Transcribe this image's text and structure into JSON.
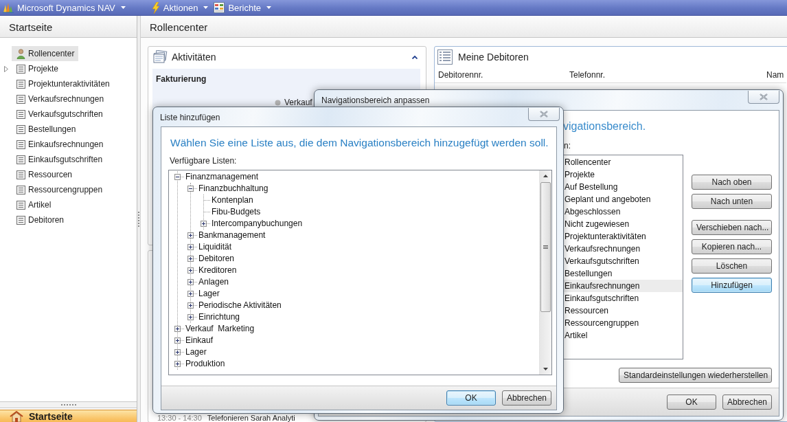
{
  "app_bar": {
    "product": "Microsoft Dynamics NAV",
    "menus": [
      {
        "kind": "actions",
        "label": "Aktionen"
      },
      {
        "kind": "reports",
        "label": "Berichte"
      }
    ]
  },
  "sidebar": {
    "title": "Startseite",
    "items": [
      {
        "kind": "role",
        "label": "Rollencenter",
        "selected": true
      },
      {
        "kind": "group",
        "label": "Projekte",
        "selected": false
      },
      {
        "kind": "list",
        "label": "Projektunteraktivitäten",
        "selected": false
      },
      {
        "kind": "list",
        "label": "Verkaufsrechnungen",
        "selected": false
      },
      {
        "kind": "list",
        "label": "Verkaufsgutschriften",
        "selected": false
      },
      {
        "kind": "list",
        "label": "Bestellungen",
        "selected": false
      },
      {
        "kind": "list",
        "label": "Einkaufsrechnungen",
        "selected": false
      },
      {
        "kind": "list",
        "label": "Einkaufsgutschriften",
        "selected": false
      },
      {
        "kind": "list",
        "label": "Ressourcen",
        "selected": false
      },
      {
        "kind": "list",
        "label": "Ressourcengruppen",
        "selected": false
      },
      {
        "kind": "list",
        "label": "Artikel",
        "selected": false
      },
      {
        "kind": "list",
        "label": "Debitoren",
        "selected": false
      }
    ],
    "footer": "Startseite"
  },
  "main": {
    "title": "Rollencenter",
    "activities": {
      "title": "Aktivitäten",
      "section": "Fakturierung",
      "cue": "Verkauf"
    },
    "agenda": {
      "time": "13:30 - 14:30",
      "subject": "Telefonieren Sarah Analyti"
    },
    "customers": {
      "title": "Meine Debitoren",
      "columns": [
        "Debitorennr.",
        "Telefonnr.",
        "Nam"
      ]
    }
  },
  "customize_dialog": {
    "title": "Navigationsbereich anpassen",
    "heading": "vigationsbereich.",
    "list_label": "n:",
    "items": [
      {
        "label": "Rollencenter",
        "selected": false
      },
      {
        "label": "Projekte",
        "selected": false
      },
      {
        "label": "Auf Bestellung",
        "selected": false
      },
      {
        "label": "Geplant und angeboten",
        "selected": false
      },
      {
        "label": "Abgeschlossen",
        "selected": false
      },
      {
        "label": "Nicht zugewiesen",
        "selected": false
      },
      {
        "label": "Projektunteraktivitäten",
        "selected": false
      },
      {
        "label": "Verkaufsrechnungen",
        "selected": false
      },
      {
        "label": "Verkaufsgutschriften",
        "selected": false
      },
      {
        "label": "Bestellungen",
        "selected": false
      },
      {
        "label": "Einkaufsrechnungen",
        "selected": true
      },
      {
        "label": "Einkaufsgutschriften",
        "selected": false
      },
      {
        "label": "Ressourcen",
        "selected": false
      },
      {
        "label": "Ressourcengruppen",
        "selected": false
      },
      {
        "label": "Artikel",
        "selected": false
      }
    ],
    "button_groups": [
      [
        {
          "label": "Nach oben",
          "default": false
        },
        {
          "label": "Nach unten",
          "default": false
        }
      ],
      [
        {
          "label": "Verschieben nach...",
          "default": false
        },
        {
          "label": "Kopieren nach...",
          "default": false
        },
        {
          "label": "Löschen",
          "default": false
        },
        {
          "label": "Hinzufügen",
          "default": true
        }
      ]
    ],
    "reset_button": "Standardeinstellungen wiederherstellen",
    "footer_buttons": [
      {
        "label": "OK",
        "default": false
      },
      {
        "label": "Abbrechen",
        "default": false
      }
    ]
  },
  "add_dialog": {
    "title": "Liste hinzufügen",
    "heading": "Wählen Sie eine Liste aus, die dem Navigationsbereich hinzugefügt werden soll.",
    "tree_label": "Verfügbare Listen:",
    "tree": [
      {
        "label": "Finanzmanagement",
        "expanded": true,
        "children": [
          {
            "label": "Finanzbuchhaltung",
            "expanded": true,
            "children": [
              {
                "label": "Kontenplan"
              },
              {
                "label": "Fibu-Budgets"
              },
              {
                "label": "Intercompanybuchungen",
                "expanded": false
              }
            ]
          },
          {
            "label": "Bankmanagement",
            "expanded": false
          },
          {
            "label": "Liquidität",
            "expanded": false
          },
          {
            "label": "Debitoren",
            "expanded": false
          },
          {
            "label": "Kreditoren",
            "expanded": false
          },
          {
            "label": "Anlagen",
            "expanded": false
          },
          {
            "label": "Lager",
            "expanded": false
          },
          {
            "label": "Periodische Aktivitäten",
            "expanded": false
          },
          {
            "label": "Einrichtung",
            "expanded": false
          }
        ]
      },
      {
        "label": "Verkauf  Marketing",
        "expanded": false
      },
      {
        "label": "Einkauf",
        "expanded": false
      },
      {
        "label": "Lager",
        "expanded": false
      },
      {
        "label": "Produktion",
        "expanded": false
      }
    ],
    "footer_buttons": [
      {
        "label": "OK",
        "default": true
      },
      {
        "label": "Abbrechen",
        "default": false
      }
    ]
  }
}
